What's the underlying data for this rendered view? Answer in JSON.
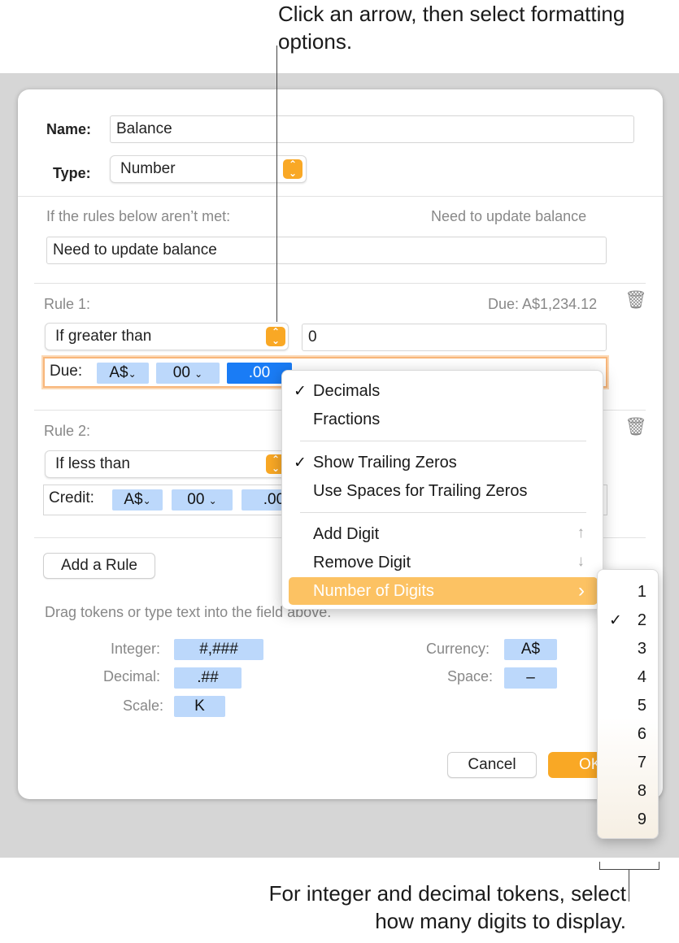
{
  "callouts": {
    "top": "Click an arrow, then select formatting options.",
    "bottom": "For integer and decimal tokens, select how many digits to display."
  },
  "dialog": {
    "name_label": "Name:",
    "name_value": "Balance",
    "type_label": "Type:",
    "type_value": "Number",
    "rules_not_met_label": "If the rules below aren’t met:",
    "rules_not_met_preview": "Need to update balance",
    "rules_not_met_value": "Need to update balance",
    "rule1": {
      "label": "Rule 1:",
      "preview": "Due: A$1,234.12",
      "condition": "If greater than",
      "value": "0",
      "tokens": {
        "prefix": "Due:",
        "currency": "A$",
        "integer": "00",
        "decimal": ".00"
      }
    },
    "rule2": {
      "label": "Rule 2:",
      "condition": "If less than",
      "tokens": {
        "prefix": "Credit:",
        "currency": "A$",
        "integer": "00",
        "decimal": ".00"
      }
    },
    "add_rule_button": "Add a Rule",
    "drag_hint": "Drag tokens or type text into the field above.",
    "token_palette": {
      "integer_label": "Integer:",
      "integer_token": "#,###",
      "decimal_label": "Decimal:",
      "decimal_token": ".##",
      "scale_label": "Scale:",
      "scale_token": "K",
      "currency_label": "Currency:",
      "currency_token": "A$",
      "space_label": "Space:",
      "space_token": "–"
    },
    "cancel_button": "Cancel",
    "ok_button": "OK"
  },
  "format_menu": {
    "decimals": "Decimals",
    "fractions": "Fractions",
    "show_trailing_zeros": "Show Trailing Zeros",
    "use_spaces": "Use Spaces for Trailing Zeros",
    "add_digit": "Add Digit",
    "remove_digit": "Remove Digit",
    "number_of_digits": "Number of Digits",
    "add_shortcut": "↑",
    "remove_shortcut": "↓",
    "submenu_arrow": "›",
    "checked_items": [
      "Decimals",
      "Show Trailing Zeros"
    ]
  },
  "digits_submenu": {
    "options": [
      "1",
      "2",
      "3",
      "4",
      "5",
      "6",
      "7",
      "8",
      "9"
    ],
    "selected": "2"
  },
  "colors": {
    "accent": "#f9a825",
    "token": "#bcd8fb",
    "token_selected": "#1a7cf5",
    "menu_highlight": "#fcc263"
  }
}
